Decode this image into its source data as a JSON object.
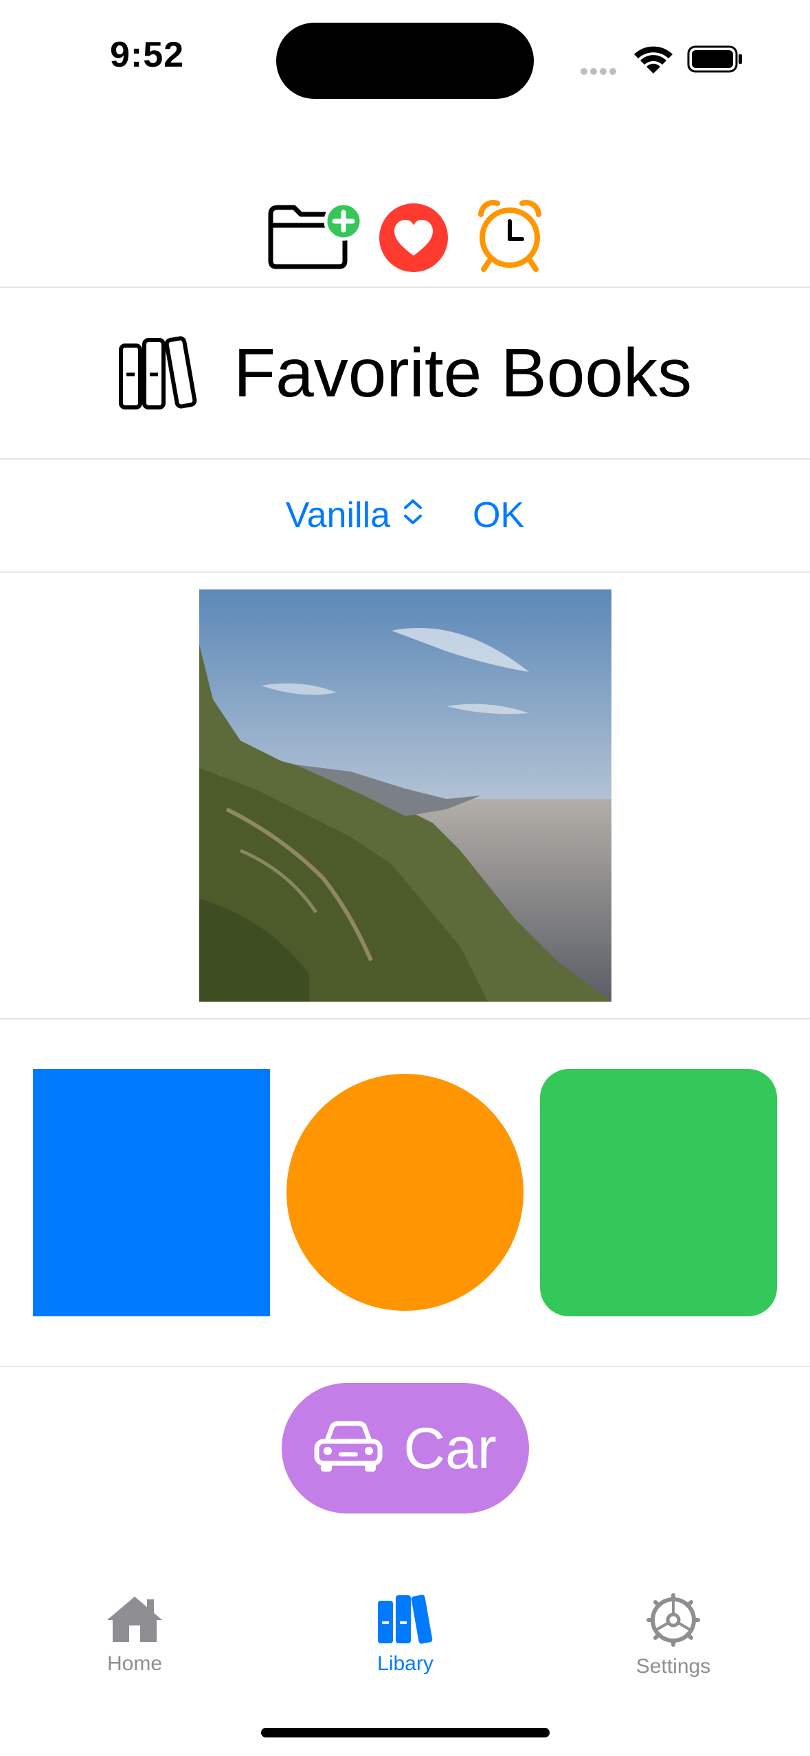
{
  "status_bar": {
    "time": "9:52"
  },
  "toolbar": {
    "icons": [
      "folder-add-icon",
      "heart-icon",
      "alarm-icon"
    ]
  },
  "header": {
    "title": "Favorite Books",
    "icon": "books-icon"
  },
  "controls": {
    "picker_value": "Vanilla",
    "ok_label": "OK"
  },
  "image": {
    "description_icon": "landscape-photo"
  },
  "shapes": {
    "colors": {
      "square": "#007aff",
      "circle": "#ff9500",
      "rounded": "#34c759"
    }
  },
  "car_button": {
    "label": "Car",
    "color": "#c47ee8"
  },
  "tab_bar": {
    "items": [
      {
        "label": "Home",
        "icon": "house-icon",
        "selected": false
      },
      {
        "label": "Libary",
        "icon": "books-icon",
        "selected": true
      },
      {
        "label": "Settings",
        "icon": "gear-icon",
        "selected": false
      }
    ],
    "active_color": "#007aff",
    "inactive_color": "#8e8e93"
  }
}
